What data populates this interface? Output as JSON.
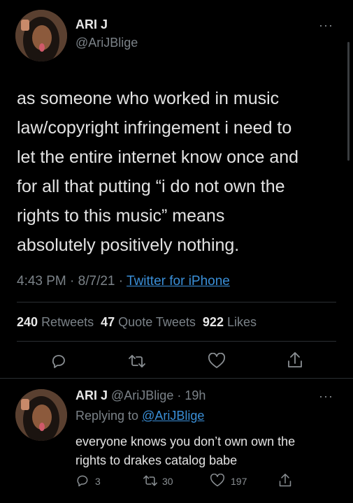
{
  "tweet": {
    "author_name": "ARI J",
    "author_handle": "@AriJBlige",
    "text_lines": [
      "as someone who worked in music",
      "law/copyright infringement i need to",
      "let the entire internet know once and",
      "for all that putting “i do not own the",
      "rights to this music” means",
      "absolutely positively nothing."
    ],
    "time": "4:43 PM",
    "date": "8/7/21",
    "source": "Twitter for iPhone",
    "retweets_count": "240",
    "retweets_label": "Retweets",
    "quotes_count": "47",
    "quotes_label": "Quote Tweets",
    "likes_count": "922",
    "likes_label": "Likes"
  },
  "reply": {
    "author_name": "ARI J",
    "author_handle": "@AriJBlige",
    "age": "19h",
    "replying_prefix": "Replying to",
    "replying_to": "@AriJBlige",
    "text_lines": [
      "everyone knows you don’t own own the",
      "rights to drakes catalog babe"
    ],
    "reply_count": "3",
    "retweet_count": "30",
    "like_count": "197"
  },
  "icons": [
    "more-icon",
    "reply-icon",
    "retweet-icon",
    "like-icon",
    "share-icon"
  ]
}
